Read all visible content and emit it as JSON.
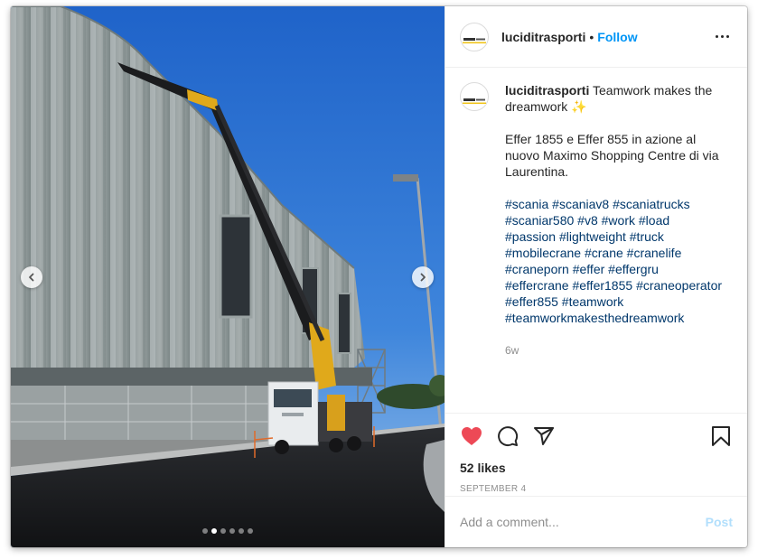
{
  "post": {
    "username": "luciditrasporti",
    "separator": "•",
    "follow_label": "Follow",
    "caption_title": "Teamwork makes the dreamwork ✨",
    "caption_body": "Effer 1855 e Effer 855 in azione al nuovo Maximo Shopping Centre di via Laurentina.",
    "hashtags": [
      "#scania",
      "#scaniav8",
      "#scaniatrucks",
      "#scaniar580",
      "#v8",
      "#work",
      "#load",
      "#passion",
      "#lightweight",
      "#truck",
      "#mobilecrane",
      "#crane",
      "#cranelife",
      "#craneporn",
      "#effer",
      "#effergru",
      "#effercrane",
      "#effer1855",
      "#craneoperator",
      "#effer855",
      "#teamwork",
      "#teamworkmakesthedreamwork"
    ],
    "age": "6w",
    "likes": "52 likes",
    "date": "SEPTEMBER 4"
  },
  "carousel": {
    "slide_count": 6,
    "active_index": 1
  },
  "comment": {
    "placeholder": "Add a comment...",
    "post_label": "Post"
  },
  "colors": {
    "accent": "#0095f6",
    "like_red": "#ed4956",
    "hashtag": "#00376b",
    "post_disabled": "#b2dffc"
  },
  "icons": [
    "chevron-left-icon",
    "chevron-right-icon",
    "more-icon",
    "heart-icon",
    "comment-icon",
    "share-icon",
    "bookmark-icon"
  ]
}
